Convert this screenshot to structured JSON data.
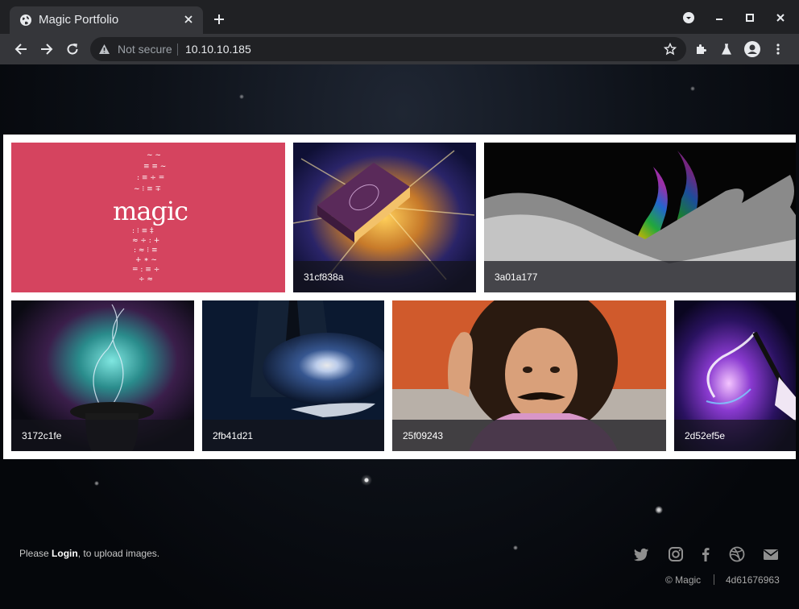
{
  "browser": {
    "tab_title": "Magic Portfolio",
    "security_label": "Not secure",
    "url": "10.10.10.185"
  },
  "gallery": {
    "items": [
      {
        "caption": "",
        "logo_text": "magic"
      },
      {
        "caption": "31cf838a"
      },
      {
        "caption": "3a01a177"
      },
      {
        "caption": "3172c1fe"
      },
      {
        "caption": "2fb41d21"
      },
      {
        "caption": "25f09243"
      },
      {
        "caption": "2d52ef5e"
      }
    ]
  },
  "footer": {
    "prefix": "Please ",
    "login": "Login",
    "suffix": ", to upload images.",
    "copyright": "© Magic",
    "hash": "4d61676963",
    "social_icons": [
      "twitter-icon",
      "instagram-icon",
      "facebook-icon",
      "dribbble-icon",
      "email-icon"
    ]
  },
  "colors": {
    "chrome_dark": "#202124",
    "chrome_toolbar": "#35363a",
    "magic_tile": "#d5445f"
  }
}
